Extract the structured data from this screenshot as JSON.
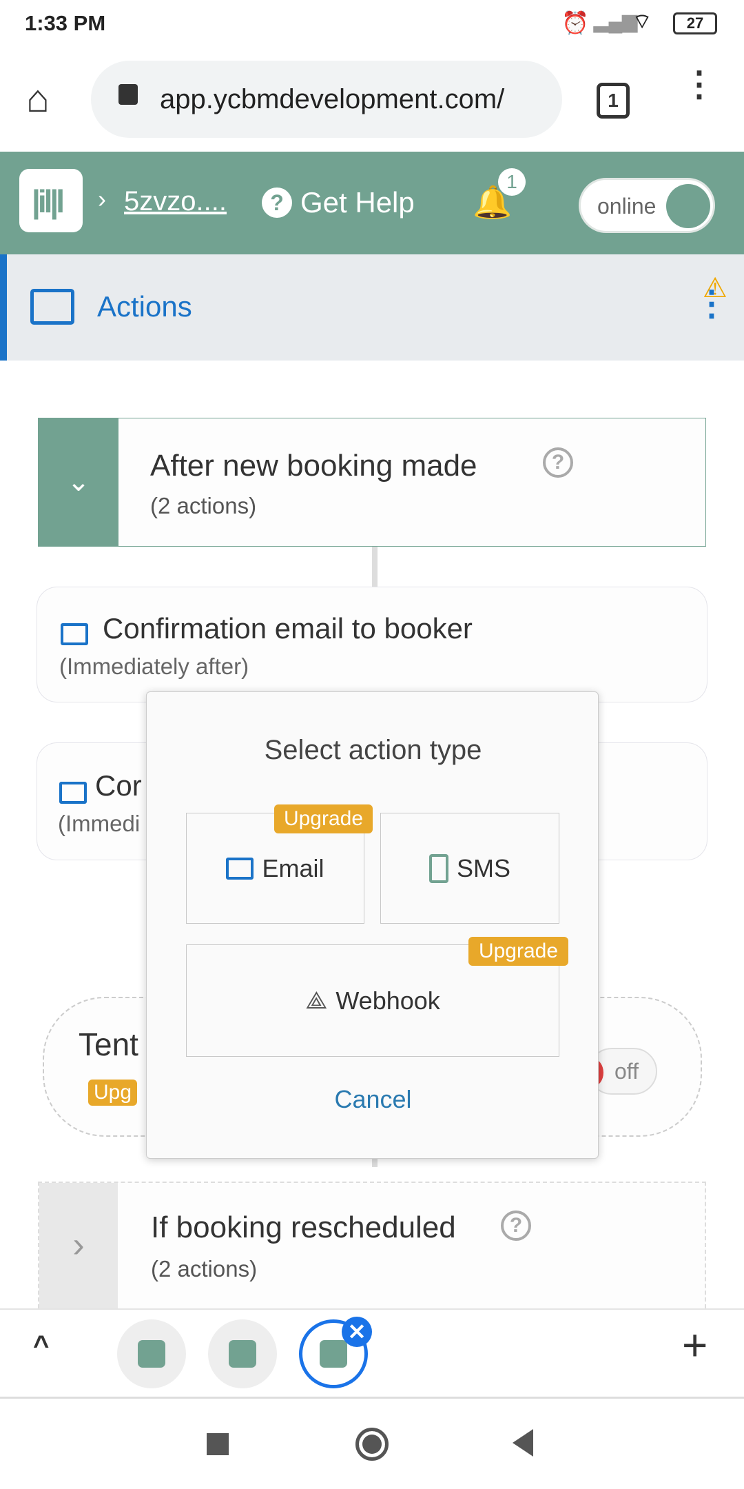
{
  "status": {
    "time": "1:33 PM",
    "battery": "27"
  },
  "browser": {
    "url": "app.ycbmdevelopment.com/",
    "tab_count": "1"
  },
  "header": {
    "breadcrumb": "5zvzo....",
    "help": "Get Help",
    "notif_count": "1",
    "toggle": "online",
    "accent": "#72a291"
  },
  "actions_bar": {
    "title": "Actions"
  },
  "trigger1": {
    "title": "After new booking made",
    "count": "(2 actions)"
  },
  "action_items": [
    {
      "title": "Confirmation email to booker",
      "timing": "(Immediately after)"
    },
    {
      "title": "Cor",
      "timing": "(Immedi"
    }
  ],
  "tentative": {
    "title": "Tent",
    "badge": "Upg",
    "toggle": "off"
  },
  "trigger2": {
    "title": "If booking rescheduled",
    "count": "(2 actions)"
  },
  "modal": {
    "title": "Select action type",
    "options": [
      {
        "label": "Email",
        "badge": "Upgrade",
        "icon": "mail-icon"
      },
      {
        "label": "SMS",
        "icon": "phone-icon"
      },
      {
        "label": "Webhook",
        "badge": "Upgrade",
        "icon": "webhook-icon"
      }
    ],
    "cancel": "Cancel"
  }
}
